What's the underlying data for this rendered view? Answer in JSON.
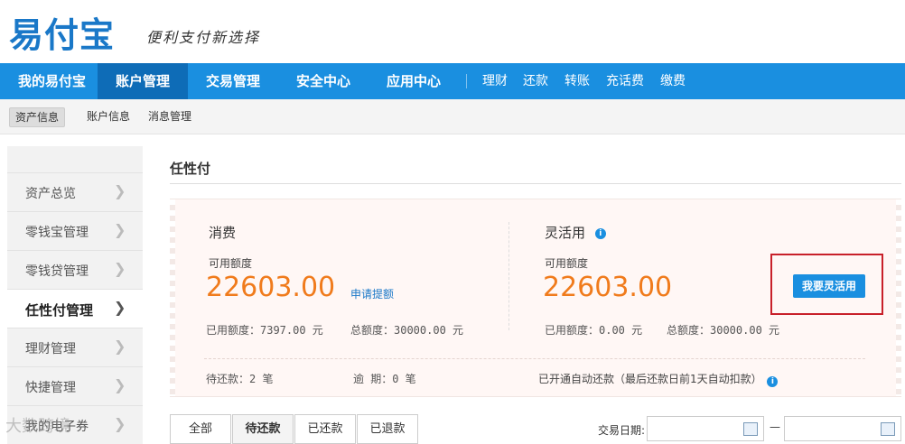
{
  "header": {
    "logo": "易付宝",
    "slogan": "便利支付新选择"
  },
  "nav": {
    "items": [
      {
        "label": "我的易付宝"
      },
      {
        "label": "账户管理"
      },
      {
        "label": "交易管理"
      },
      {
        "label": "安全中心"
      },
      {
        "label": "应用中心"
      }
    ],
    "subitems": [
      "理财",
      "还款",
      "转账",
      "充话费",
      "缴费"
    ]
  },
  "subnav": {
    "items": [
      "资产信息",
      "账户信息",
      "消息管理"
    ]
  },
  "sidebar": {
    "items": [
      "资产总览",
      "零钱宝管理",
      "零钱贷管理",
      "任性付管理",
      "理财管理",
      "快捷管理",
      "我的电子券"
    ]
  },
  "page": {
    "title": "任性付"
  },
  "card": {
    "consume": {
      "heading": "消费",
      "available_label": "可用额度",
      "available_value": "22603.00",
      "increase_link": "申请提额",
      "used_text": "已用额度：7397.00 元",
      "total_text": "总额度：30000.00 元"
    },
    "flexible": {
      "heading": "灵活用",
      "available_label": "可用额度",
      "available_value": "22603.00",
      "used_text": "已用额度：0.00 元",
      "total_text": "总额度：30000.00 元",
      "button": "我要灵活用"
    },
    "pending_text": "待还款：2 笔",
    "overdue_text": "逾  期：0 笔",
    "autopay_text": "已开通自动还款（最后还款日前1天自动扣款）"
  },
  "tabs": [
    "全部",
    "待还款",
    "已还款",
    "已退款"
  ],
  "filter": {
    "date_label": "交易日期:",
    "separator": "—"
  },
  "watermark": "大数跨境"
}
